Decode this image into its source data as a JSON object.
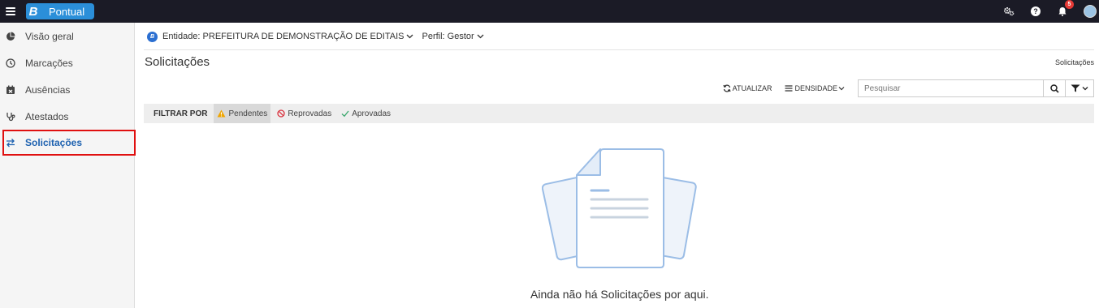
{
  "app": {
    "brand_letter": "B",
    "brand_name": "Pontual",
    "notification_count": "5"
  },
  "topbar": {
    "icons": [
      "settings-gears-icon",
      "help-icon",
      "bell-icon",
      "avatar"
    ]
  },
  "sidebar": {
    "items": [
      {
        "label": "Visão geral",
        "icon": "pie-chart-icon"
      },
      {
        "label": "Marcações",
        "icon": "clock-icon"
      },
      {
        "label": "Ausências",
        "icon": "calendar-x-icon"
      },
      {
        "label": "Atestados",
        "icon": "stethoscope-icon"
      },
      {
        "label": "Solicitações",
        "icon": "swap-arrows-icon",
        "active": true
      }
    ]
  },
  "context": {
    "entity_badge": "B",
    "entity": "Entidade: PREFEITURA DE DEMONSTRAÇÃO DE EDITAIS",
    "profile": "Perfil: Gestor"
  },
  "page": {
    "title": "Solicitações",
    "breadcrumb": "Solicitações"
  },
  "toolbar": {
    "refresh_label": "ATUALIZAR",
    "density_label": "DENSIDADE",
    "search_placeholder": "Pesquisar"
  },
  "filters": {
    "label": "FILTRAR POR",
    "options": [
      {
        "label": "Pendentes",
        "selected": true,
        "color": "#f0a500"
      },
      {
        "label": "Reprovadas",
        "selected": false,
        "color": "#d9333f"
      },
      {
        "label": "Aprovadas",
        "selected": false,
        "color": "#3aa76d"
      }
    ]
  },
  "empty_state": {
    "message": "Ainda não há Solicitações por aqui."
  },
  "colors": {
    "topbar": "#1b1b26",
    "brand": "#2b8fd9",
    "active_nav": "#1e62b0",
    "highlight_border": "#e01010"
  }
}
